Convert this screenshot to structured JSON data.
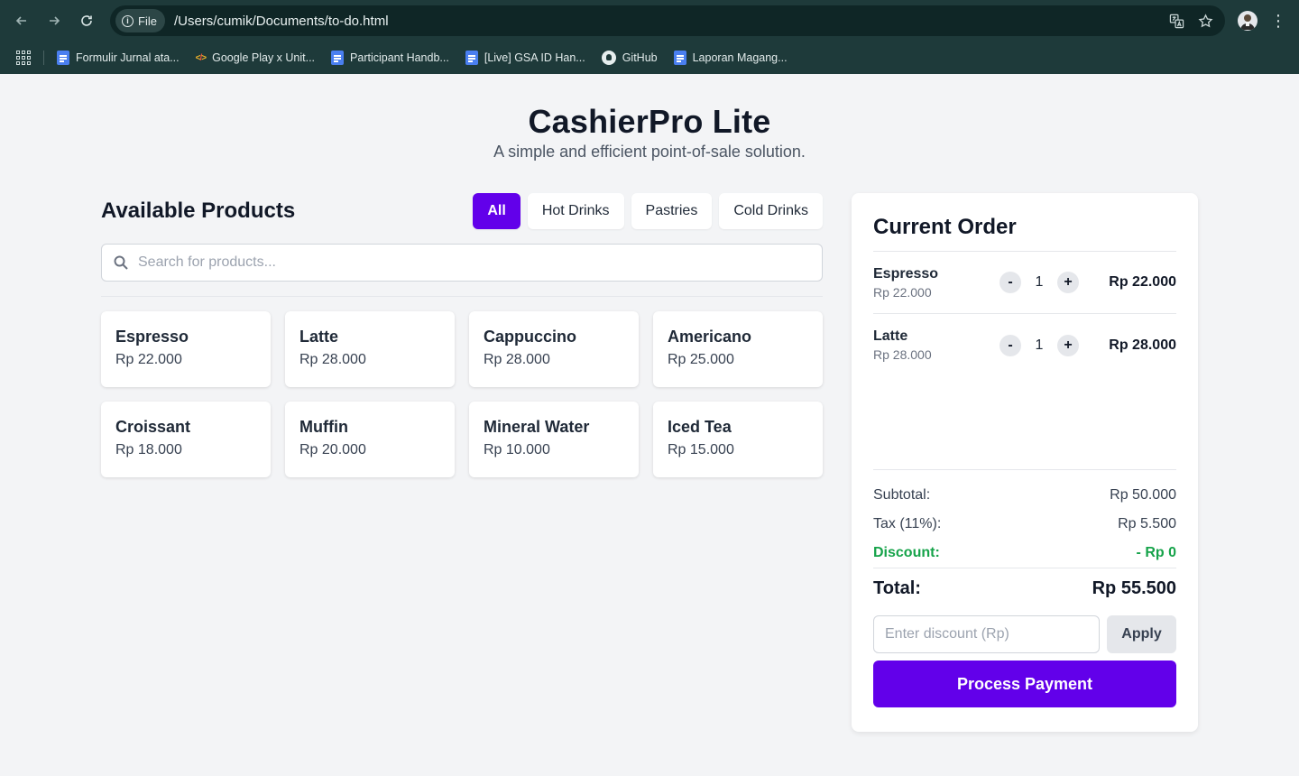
{
  "browser": {
    "site_chip": "File",
    "url": "/Users/cumik/Documents/to-do.html",
    "bookmarks": [
      {
        "label": "Formulir Jurnal ata...",
        "icon": "google-docs-icon"
      },
      {
        "label": "Google Play x Unit...",
        "icon": "code-icon"
      },
      {
        "label": "Participant Handb...",
        "icon": "google-docs-icon"
      },
      {
        "label": "[Live] GSA ID Han...",
        "icon": "google-docs-icon"
      },
      {
        "label": "GitHub",
        "icon": "github-icon"
      },
      {
        "label": "Laporan Magang...",
        "icon": "google-docs-icon"
      }
    ]
  },
  "header": {
    "title": "CashierPro Lite",
    "subtitle": "A simple and efficient point-of-sale solution."
  },
  "products": {
    "title": "Available Products",
    "filters": [
      "All",
      "Hot Drinks",
      "Pastries",
      "Cold Drinks"
    ],
    "active_filter": "All",
    "search_placeholder": "Search for products...",
    "items": [
      {
        "name": "Espresso",
        "price": "Rp 22.000"
      },
      {
        "name": "Latte",
        "price": "Rp 28.000"
      },
      {
        "name": "Cappuccino",
        "price": "Rp 28.000"
      },
      {
        "name": "Americano",
        "price": "Rp 25.000"
      },
      {
        "name": "Croissant",
        "price": "Rp 18.000"
      },
      {
        "name": "Muffin",
        "price": "Rp 20.000"
      },
      {
        "name": "Mineral Water",
        "price": "Rp 10.000"
      },
      {
        "name": "Iced Tea",
        "price": "Rp 15.000"
      }
    ]
  },
  "order": {
    "title": "Current Order",
    "items": [
      {
        "name": "Espresso",
        "unit_price": "Rp 22.000",
        "qty": "1",
        "line_total": "Rp 22.000",
        "minus": "-",
        "plus": "+"
      },
      {
        "name": "Latte",
        "unit_price": "Rp 28.000",
        "qty": "1",
        "line_total": "Rp 28.000",
        "minus": "-",
        "plus": "+"
      }
    ],
    "subtotal_label": "Subtotal:",
    "subtotal": "Rp 50.000",
    "tax_label": "Tax (11%):",
    "tax": "Rp 5.500",
    "discount_label": "Discount:",
    "discount": "- Rp 0",
    "total_label": "Total:",
    "total": "Rp 55.500",
    "discount_placeholder": "Enter discount (Rp)",
    "apply_label": "Apply",
    "pay_label": "Process Payment"
  },
  "colors": {
    "accent": "#6200ea",
    "discount": "#16a34a",
    "chrome": "#1e3a3a"
  }
}
